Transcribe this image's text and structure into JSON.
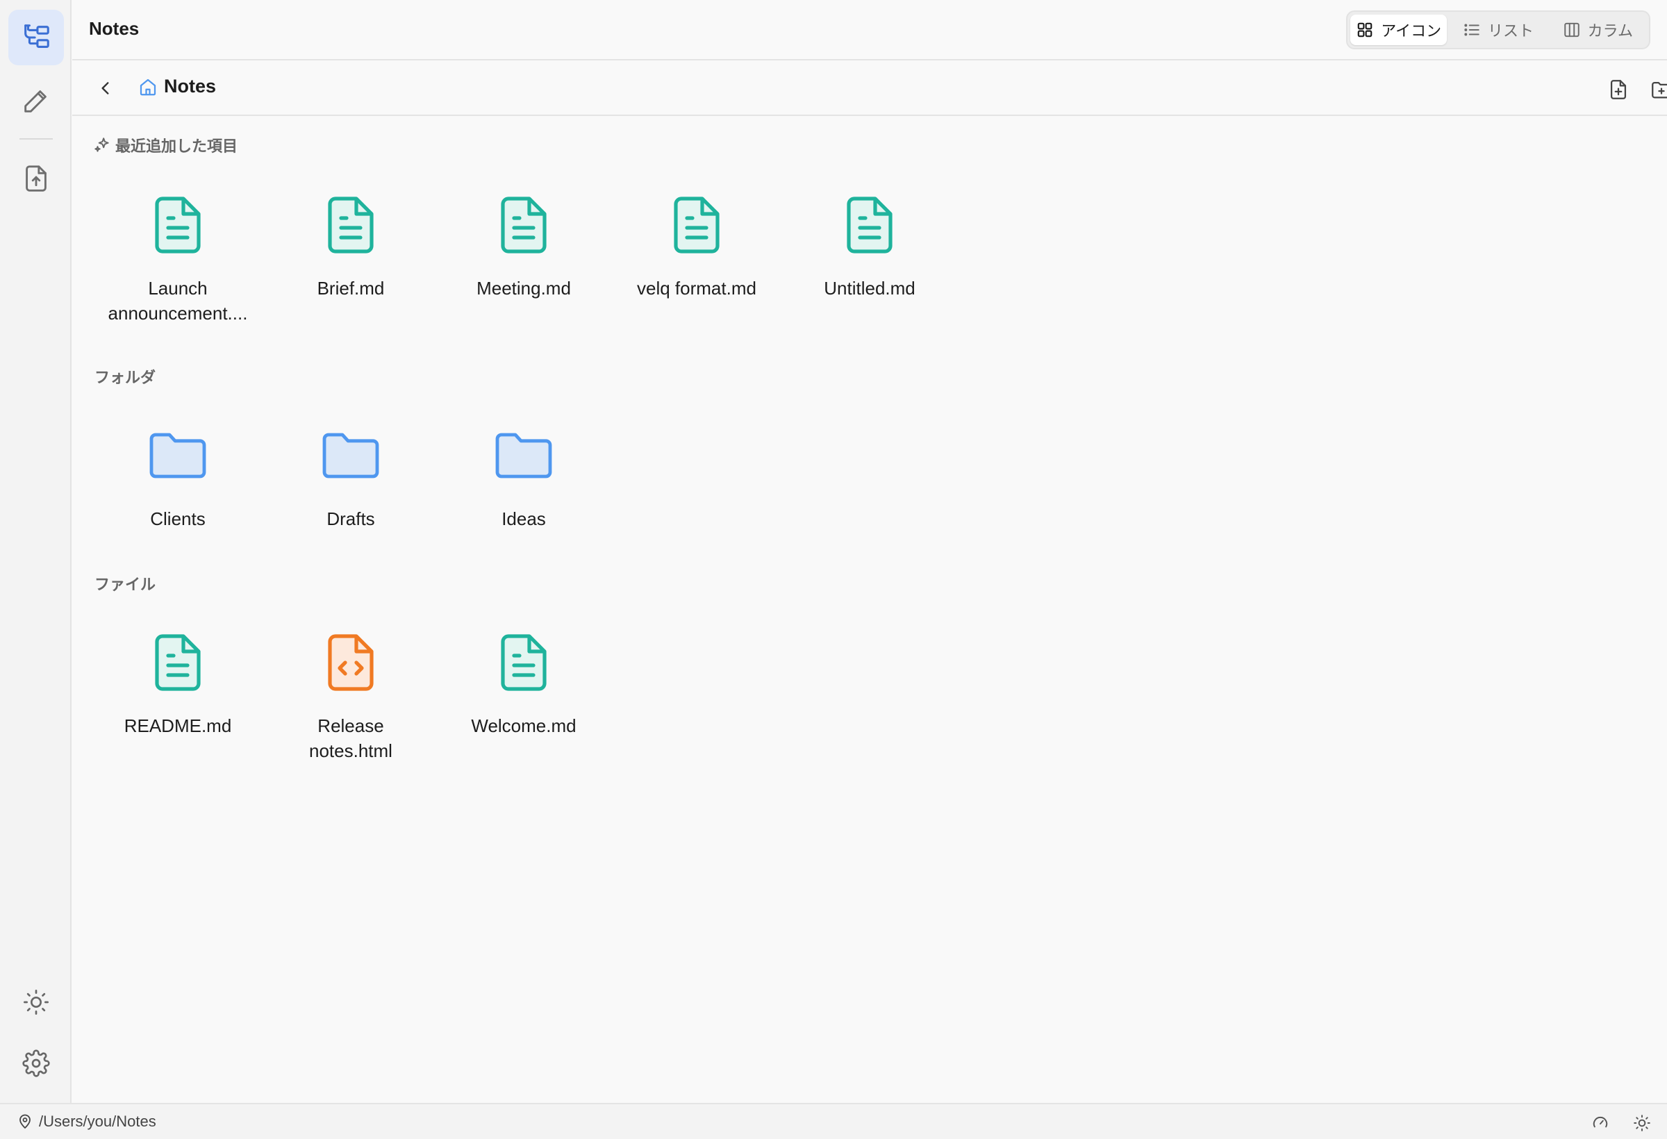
{
  "app": {
    "window_title": "Notes"
  },
  "rail": {
    "items": [
      {
        "name": "file-tree-icon",
        "active": true
      },
      {
        "name": "pencil-icon",
        "active": false
      },
      {
        "name": "file-upload-icon",
        "active": false
      }
    ],
    "bottom": [
      "sun-icon",
      "gear-icon"
    ]
  },
  "view_switch": {
    "options": [
      {
        "label": "アイコン",
        "icon": "grid-icon",
        "selected": true
      },
      {
        "label": "リスト",
        "icon": "list-icon",
        "selected": false
      },
      {
        "label": "カラム",
        "icon": "columns-icon",
        "selected": false
      }
    ]
  },
  "navbar": {
    "breadcrumb": "Notes",
    "actions": [
      "new-file-icon",
      "new-folder-icon"
    ]
  },
  "sections": {
    "recent": {
      "title": "最近追加した項目",
      "items": [
        {
          "label": "Launch announcement....",
          "kind": "markdown"
        },
        {
          "label": "Brief.md",
          "kind": "markdown"
        },
        {
          "label": "Meeting.md",
          "kind": "markdown"
        },
        {
          "label": "velq format.md",
          "kind": "markdown"
        },
        {
          "label": "Untitled.md",
          "kind": "markdown"
        }
      ]
    },
    "folders": {
      "title": "フォルダ",
      "items": [
        {
          "label": "Clients",
          "kind": "folder"
        },
        {
          "label": "Drafts",
          "kind": "folder"
        },
        {
          "label": "Ideas",
          "kind": "folder"
        }
      ]
    },
    "files": {
      "title": "ファイル",
      "items": [
        {
          "label": "README.md",
          "kind": "markdown"
        },
        {
          "label": "Release notes.html",
          "kind": "html"
        },
        {
          "label": "Welcome.md",
          "kind": "markdown"
        }
      ]
    }
  },
  "statusbar": {
    "path": "/Users/you/Notes",
    "icons": [
      "gauge-icon",
      "sun-icon"
    ]
  },
  "colors": {
    "markdown": "#1fb39c",
    "markdown_fill": "#e3f5f1",
    "folder": "#4f97ef",
    "folder_fill": "#dce8f8",
    "html": "#f07a23",
    "html_fill": "#fde9dc",
    "accent": "#3b6fd4"
  }
}
